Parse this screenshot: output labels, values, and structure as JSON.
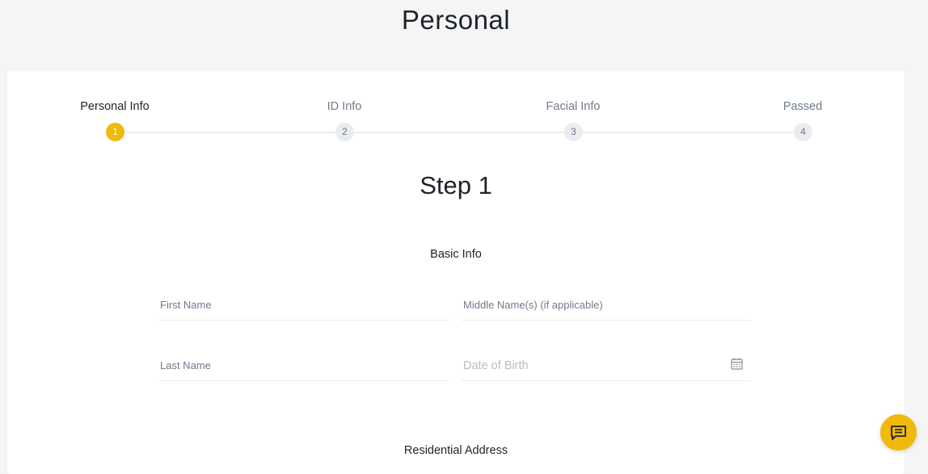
{
  "page": {
    "title": "Personal"
  },
  "stepper": {
    "steps": [
      {
        "label": "Personal Info",
        "number": "1",
        "state": "active"
      },
      {
        "label": "ID Info",
        "number": "2",
        "state": "inactive"
      },
      {
        "label": "Facial Info",
        "number": "3",
        "state": "inactive"
      },
      {
        "label": "Passed",
        "number": "4",
        "state": "inactive"
      }
    ]
  },
  "form": {
    "step_heading": "Step 1",
    "basic_info": {
      "title": "Basic Info",
      "first_name": {
        "placeholder": "First Name",
        "value": ""
      },
      "middle_name": {
        "placeholder": "Middle Name(s) (if applicable)",
        "value": ""
      },
      "last_name": {
        "placeholder": "Last Name",
        "value": ""
      },
      "date_of_birth": {
        "placeholder": "Date of Birth",
        "value": "",
        "icon": "calendar-icon"
      }
    },
    "residential_address": {
      "title": "Residential Address"
    }
  },
  "chat": {
    "icon": "chat-icon"
  },
  "colors": {
    "accent": "#f0b90b",
    "text": "#1e2329",
    "muted": "#707a8a",
    "line": "#eaecef"
  }
}
